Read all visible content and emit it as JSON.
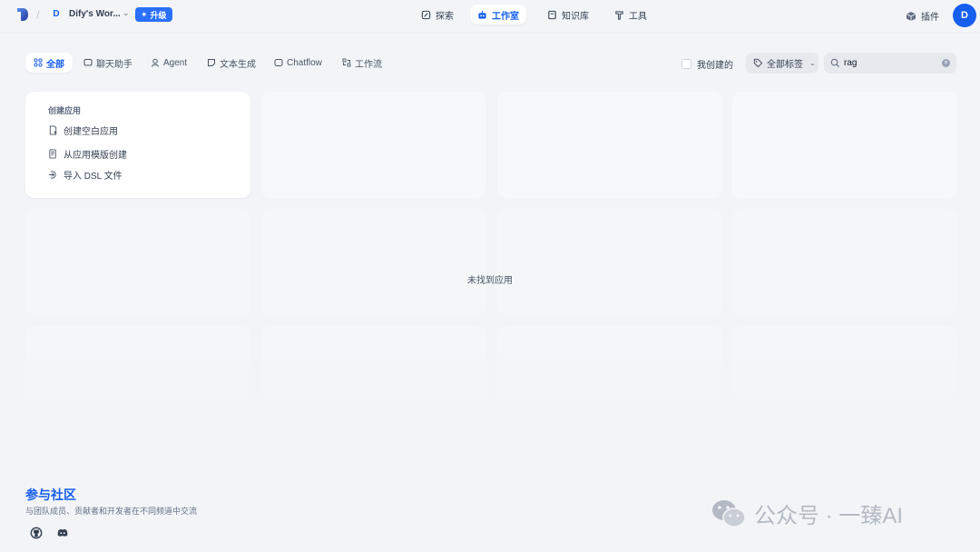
{
  "header": {
    "workspace_initial": "D",
    "workspace_name": "Dify's Wor...",
    "upgrade_label": "升级",
    "nav": [
      {
        "label": "探索",
        "icon": "explore-icon",
        "active": false
      },
      {
        "label": "工作室",
        "icon": "robot-icon",
        "active": true
      },
      {
        "label": "知识库",
        "icon": "book-icon",
        "active": false
      },
      {
        "label": "工具",
        "icon": "hammer-icon",
        "active": false
      }
    ],
    "plugins_label": "插件",
    "user_initial": "D"
  },
  "filters": {
    "tabs": [
      {
        "label": "全部",
        "icon": "grid-icon",
        "active": true
      },
      {
        "label": "聊天助手",
        "icon": "chat-icon",
        "active": false
      },
      {
        "label": "Agent",
        "icon": "agent-icon",
        "active": false
      },
      {
        "label": "文本生成",
        "icon": "note-icon",
        "active": false
      },
      {
        "label": "Chatflow",
        "icon": "chatflow-icon",
        "active": false
      },
      {
        "label": "工作流",
        "icon": "workflow-icon",
        "active": false
      }
    ],
    "mine_label": "我创建的",
    "mine_checked": false,
    "tag_select_label": "全部标签",
    "search_value": "rag"
  },
  "create_card": {
    "title": "创建应用",
    "items": [
      {
        "label": "创建空白应用",
        "icon": "blank-file-icon"
      },
      {
        "label": "从应用模版创建",
        "icon": "template-icon"
      },
      {
        "label": "导入 DSL 文件",
        "icon": "import-icon"
      }
    ]
  },
  "empty_message": "未找到应用",
  "footer": {
    "community_title": "参与社区",
    "community_desc": "与团队成员、贡献者和开发者在不同频道中交流"
  },
  "watermark": {
    "text": "公众号 · 一臻AI"
  },
  "colors": {
    "accent": "#155eef",
    "background": "#f2f4f7"
  }
}
